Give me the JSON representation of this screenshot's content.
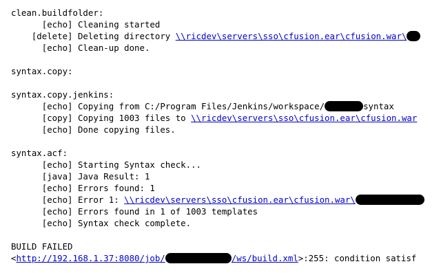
{
  "log": {
    "clean_target": "clean.buildfolder:",
    "clean_echo_start": "      [echo] Cleaning started",
    "clean_delete_prefix": "    [delete] Deleting directory ",
    "clean_delete_path": "\\\\ricdev\\servers\\sso\\cfusion.ear\\cfusion.war\\",
    "clean_echo_done": "      [echo] Clean-up done.",
    "syntax_copy_target": "syntax.copy:",
    "syntax_copy_jenkins_target": "syntax.copy.jenkins:",
    "copy_from_prefix": "      [echo] Copying from C:/Program Files/Jenkins/workspace/",
    "copy_from_suffix": "syntax",
    "copy_files_prefix": "      [copy] Copying 1003 files to ",
    "copy_files_path": "\\\\ricdev\\servers\\sso\\cfusion.ear\\cfusion.war",
    "copy_done": "      [echo] Done copying files.",
    "syntax_acf_target": "syntax.acf:",
    "acf_start": "      [echo] Starting Syntax check...",
    "acf_java_result": "      [java] Java Result: 1",
    "acf_errors_found": "      [echo] Errors found: 1",
    "acf_error1_prefix": "      [echo] Error 1: ",
    "acf_error1_path": "\\\\ricdev\\servers\\sso\\cfusion.ear\\cfusion.war\\",
    "acf_errors_templates": "      [echo] Errors found in 1 of 1003 templates",
    "acf_complete": "      [echo] Syntax check complete.",
    "build_failed": "BUILD FAILED",
    "build_url_open": "<",
    "build_url_prefix": "http://192.168.1.37:8080/job/",
    "build_url_suffix": "/ws/build.xml",
    "build_url_tail": ">:255: condition satisf"
  }
}
